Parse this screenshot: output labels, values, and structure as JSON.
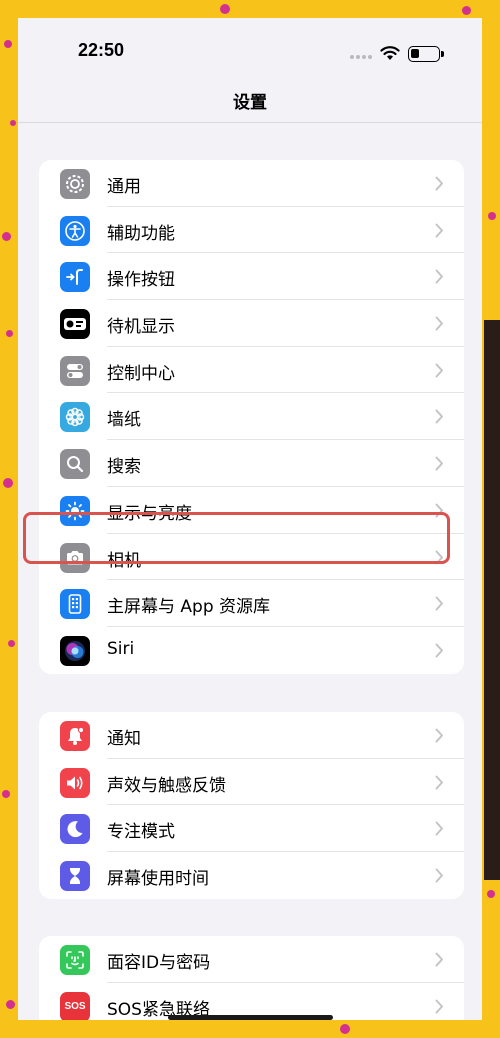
{
  "status_bar": {
    "time": "22:50"
  },
  "nav": {
    "title": "设置"
  },
  "groups": [
    {
      "rows": [
        {
          "id": "general",
          "label": "通用",
          "icon": "gear-icon",
          "color": "#8e8e93"
        },
        {
          "id": "accessibility",
          "label": "辅助功能",
          "icon": "accessibility-icon",
          "color": "#1a7ff0"
        },
        {
          "id": "action-button",
          "label": "操作按钮",
          "icon": "action-button-icon",
          "color": "#1a7ff0"
        },
        {
          "id": "standby",
          "label": "待机显示",
          "icon": "standby-icon",
          "color": "#000000"
        },
        {
          "id": "control-center",
          "label": "控制中心",
          "icon": "switches-icon",
          "color": "#8e8e93"
        },
        {
          "id": "wallpaper",
          "label": "墙纸",
          "icon": "flower-icon",
          "color": "#36a9e0"
        },
        {
          "id": "search",
          "label": "搜索",
          "icon": "search-icon",
          "color": "#8e8e93"
        },
        {
          "id": "display",
          "label": "显示与亮度",
          "icon": "sun-icon",
          "color": "#1a7ff0"
        },
        {
          "id": "camera",
          "label": "相机",
          "icon": "camera-icon",
          "color": "#8e8e93"
        },
        {
          "id": "home-screen",
          "label": "主屏幕与 App 资源库",
          "icon": "home-grid-icon",
          "color": "#1a7ff0"
        },
        {
          "id": "siri",
          "label": "Siri",
          "icon": "siri-icon",
          "color": "#000000"
        }
      ]
    },
    {
      "rows": [
        {
          "id": "notifications",
          "label": "通知",
          "icon": "bell-icon",
          "color": "#f0434b"
        },
        {
          "id": "sounds",
          "label": "声效与触感反馈",
          "icon": "speaker-icon",
          "color": "#f0434b"
        },
        {
          "id": "focus",
          "label": "专注模式",
          "icon": "moon-icon",
          "color": "#5e5ce6"
        },
        {
          "id": "screen-time",
          "label": "屏幕使用时间",
          "icon": "hourglass-icon",
          "color": "#5e5ce6"
        }
      ]
    },
    {
      "rows": [
        {
          "id": "face-id",
          "label": "面容ID与密码",
          "icon": "face-id-icon",
          "color": "#34c759"
        },
        {
          "id": "sos",
          "label": "SOS紧急联络",
          "icon": "sos-icon",
          "color": "#e8333a",
          "icon_text": "SOS"
        }
      ]
    }
  ]
}
